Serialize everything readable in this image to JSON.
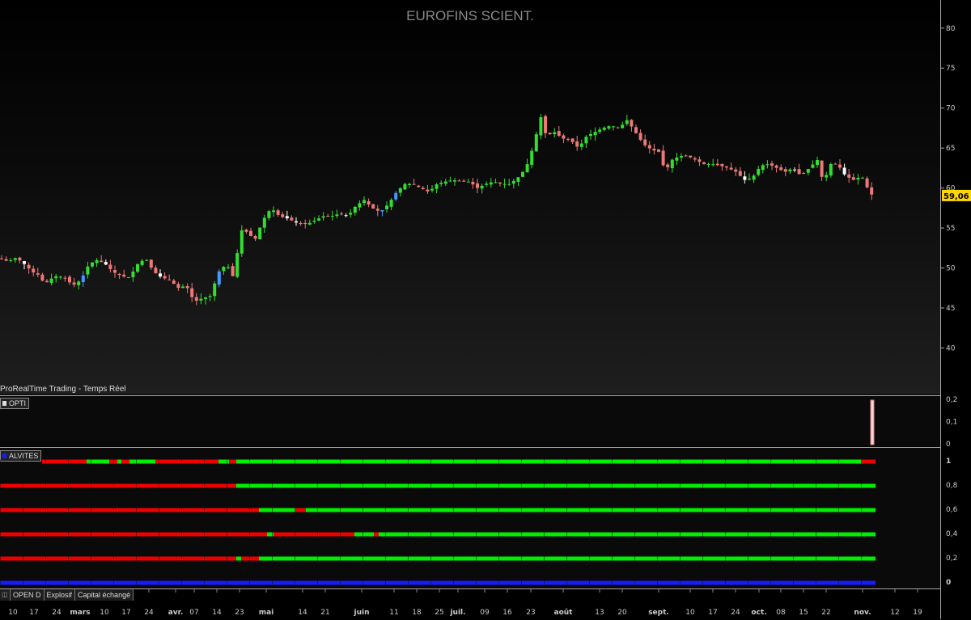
{
  "window": {
    "title": "EUROFINS SCIENT.",
    "source_label": "ProRealTime Trading - Temps Réel"
  },
  "indicators": {
    "opti_label": "OPTI",
    "alvites_label": "ALVITES"
  },
  "toolbar": {
    "items": [
      "OPEN D",
      "Explosif",
      "Capital échangé"
    ]
  },
  "colors": {
    "up": "#33dd33",
    "down": "#ee7777",
    "up_alt": "#4499ff",
    "down_alt": "#ffffff",
    "signal_on": "#00ee00",
    "signal_off": "#ee0000",
    "baseline": "#1a1aff",
    "last_price_badge": "#ffd700"
  },
  "chart_data": {
    "type": "candlestick",
    "title": "EUROFINS SCIENT.",
    "last_price_label": "59,06",
    "last_price": 59.06,
    "ylim": [
      36,
      82
    ],
    "y_ticks": [
      {
        "v": 80,
        "label": "80"
      },
      {
        "v": 75,
        "label": "75"
      },
      {
        "v": 70,
        "label": "70"
      },
      {
        "v": 65,
        "label": "65"
      },
      {
        "v": 60,
        "label": "60"
      },
      {
        "v": 55,
        "label": "55"
      },
      {
        "v": 50,
        "label": "50"
      },
      {
        "v": 45,
        "label": "45"
      },
      {
        "v": 40,
        "label": "40"
      }
    ],
    "x_ticks": [
      "10",
      "17",
      "24",
      "mars",
      "10",
      "17",
      "24",
      "avr.",
      "07",
      "14",
      "23",
      "mai",
      "14",
      "21",
      "juin",
      "11",
      "18",
      "25",
      "juil.",
      "09",
      "16",
      "23",
      "août",
      "13",
      "20",
      "sept.",
      "10",
      "17",
      "24",
      "oct.",
      "08",
      "15",
      "22",
      "nov.",
      "12",
      "19"
    ],
    "close_points": [
      [
        0,
        51.2
      ],
      [
        10,
        50.8
      ],
      [
        20,
        51.3
      ],
      [
        30,
        50.5
      ],
      [
        40,
        49.5
      ],
      [
        50,
        49.0
      ],
      [
        55,
        47.8
      ],
      [
        60,
        48.5
      ],
      [
        70,
        49.0
      ],
      [
        80,
        48.8
      ],
      [
        90,
        47.8
      ],
      [
        100,
        48.5
      ],
      [
        110,
        50.5
      ],
      [
        120,
        51.0
      ],
      [
        130,
        50.5
      ],
      [
        140,
        49.5
      ],
      [
        150,
        49.0
      ],
      [
        160,
        48.8
      ],
      [
        170,
        50.5
      ],
      [
        180,
        51.2
      ],
      [
        190,
        49.5
      ],
      [
        200,
        48.8
      ],
      [
        210,
        48.5
      ],
      [
        220,
        47.5
      ],
      [
        230,
        47.8
      ],
      [
        240,
        45.8
      ],
      [
        250,
        46.2
      ],
      [
        260,
        46.5
      ],
      [
        270,
        49.5
      ],
      [
        280,
        50.5
      ],
      [
        290,
        48.5
      ],
      [
        296,
        54.8
      ],
      [
        305,
        54.5
      ],
      [
        315,
        53.5
      ],
      [
        325,
        56.0
      ],
      [
        335,
        57.5
      ],
      [
        345,
        56.5
      ],
      [
        355,
        56.2
      ],
      [
        370,
        55.5
      ],
      [
        380,
        55.5
      ],
      [
        390,
        56.0
      ],
      [
        400,
        56.5
      ],
      [
        410,
        56.5
      ],
      [
        420,
        56.8
      ],
      [
        430,
        56.5
      ],
      [
        440,
        57.8
      ],
      [
        450,
        58.5
      ],
      [
        460,
        57.5
      ],
      [
        470,
        57.0
      ],
      [
        480,
        58.0
      ],
      [
        490,
        59.5
      ],
      [
        500,
        60.5
      ],
      [
        510,
        60.5
      ],
      [
        520,
        60.0
      ],
      [
        530,
        59.5
      ],
      [
        540,
        60.5
      ],
      [
        550,
        60.8
      ],
      [
        560,
        61.0
      ],
      [
        570,
        60.8
      ],
      [
        580,
        60.8
      ],
      [
        590,
        60.0
      ],
      [
        600,
        60.5
      ],
      [
        610,
        60.8
      ],
      [
        620,
        60.5
      ],
      [
        630,
        60.5
      ],
      [
        640,
        61.3
      ],
      [
        650,
        62.5
      ],
      [
        660,
        65.5
      ],
      [
        668,
        69.0
      ],
      [
        675,
        66.5
      ],
      [
        685,
        67.0
      ],
      [
        695,
        66.2
      ],
      [
        705,
        66.0
      ],
      [
        715,
        65.0
      ],
      [
        725,
        66.5
      ],
      [
        735,
        67.0
      ],
      [
        745,
        67.5
      ],
      [
        755,
        67.8
      ],
      [
        765,
        67.5
      ],
      [
        775,
        68.5
      ],
      [
        785,
        67.0
      ],
      [
        795,
        65.5
      ],
      [
        805,
        64.8
      ],
      [
        815,
        64.5
      ],
      [
        822,
        62.0
      ],
      [
        830,
        63.5
      ],
      [
        840,
        64.0
      ],
      [
        850,
        64.0
      ],
      [
        860,
        63.5
      ],
      [
        870,
        63.0
      ],
      [
        880,
        63.0
      ],
      [
        890,
        62.8
      ],
      [
        900,
        62.5
      ],
      [
        910,
        62.0
      ],
      [
        920,
        61.0
      ],
      [
        930,
        61.3
      ],
      [
        940,
        62.8
      ],
      [
        950,
        63.0
      ],
      [
        960,
        62.5
      ],
      [
        970,
        62.0
      ],
      [
        980,
        62.5
      ],
      [
        990,
        61.5
      ],
      [
        1000,
        62.5
      ],
      [
        1010,
        63.5
      ],
      [
        1018,
        60.5
      ],
      [
        1025,
        63.0
      ],
      [
        1035,
        63.0
      ],
      [
        1045,
        61.5
      ],
      [
        1055,
        61.0
      ],
      [
        1065,
        61.5
      ],
      [
        1072,
        60.0
      ],
      [
        1078,
        59.06
      ]
    ],
    "opti": {
      "ylim": [
        0,
        0.2
      ],
      "y_ticks": [
        {
          "v": 0.2,
          "label": "0,2"
        },
        {
          "v": 0.1,
          "label": "0,1"
        },
        {
          "v": 0,
          "label": "0"
        }
      ],
      "spike_value": 0.2
    },
    "alvites": {
      "ylim": [
        0,
        1
      ],
      "y_ticks": [
        {
          "v": 1,
          "label": "1"
        },
        {
          "v": 0.8,
          "label": "0,8"
        },
        {
          "v": 0.6,
          "label": "0,6"
        },
        {
          "v": 0.4,
          "label": "0,4"
        },
        {
          "v": 0.2,
          "label": "0,2"
        },
        {
          "v": 0,
          "label": "0"
        }
      ],
      "rows": [
        {
          "v": 1.0,
          "segments": [
            [
              0,
              52,
              "bg"
            ],
            [
              52,
              107,
              "off"
            ],
            [
              107,
              135,
              "on"
            ],
            [
              135,
              145,
              "off"
            ],
            [
              145,
              150,
              "on"
            ],
            [
              150,
              160,
              "off"
            ],
            [
              160,
              170,
              "on"
            ],
            [
              170,
              192,
              "on"
            ],
            [
              192,
              270,
              "off"
            ],
            [
              270,
              283,
              "on"
            ],
            [
              283,
              292,
              "off"
            ],
            [
              292,
              1065,
              "on"
            ],
            [
              1065,
              1082,
              "off"
            ]
          ]
        },
        {
          "v": 0.8,
          "segments": [
            [
              0,
              292,
              "off"
            ],
            [
              292,
              1082,
              "on"
            ]
          ]
        },
        {
          "v": 0.6,
          "segments": [
            [
              0,
              320,
              "off"
            ],
            [
              320,
              365,
              "on"
            ],
            [
              365,
              378,
              "off"
            ],
            [
              378,
              1082,
              "on"
            ]
          ]
        },
        {
          "v": 0.4,
          "segments": [
            [
              0,
              330,
              "off"
            ],
            [
              330,
              338,
              "on"
            ],
            [
              338,
              438,
              "off"
            ],
            [
              438,
              462,
              "on"
            ],
            [
              462,
              468,
              "off"
            ],
            [
              468,
              1082,
              "on"
            ]
          ]
        },
        {
          "v": 0.2,
          "segments": [
            [
              0,
              292,
              "off"
            ],
            [
              292,
              298,
              "on"
            ],
            [
              298,
              320,
              "off"
            ],
            [
              320,
              1082,
              "on"
            ]
          ]
        },
        {
          "v": 0.0,
          "segments": [
            [
              0,
              1082,
              "base"
            ]
          ]
        }
      ]
    }
  }
}
